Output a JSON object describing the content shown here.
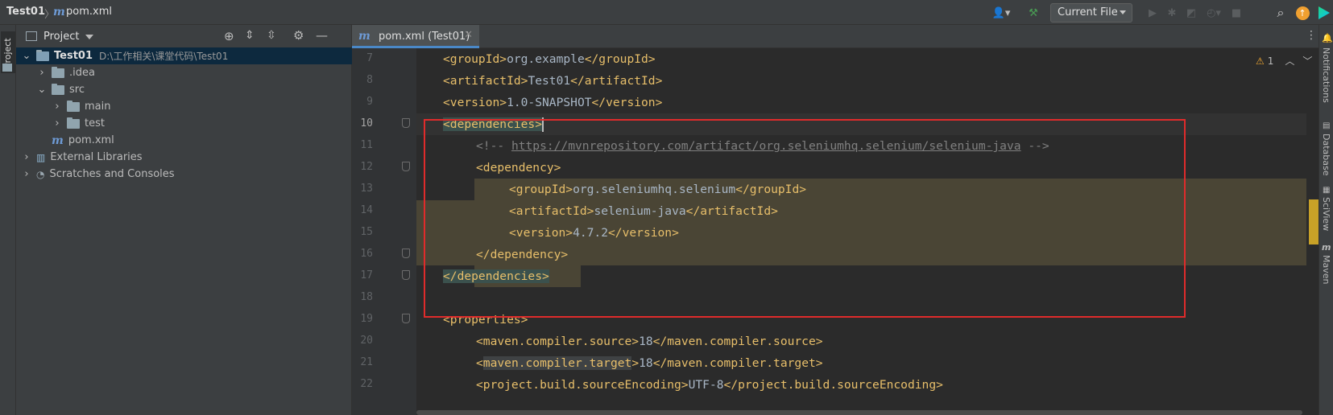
{
  "breadcrumb": {
    "project": "Test01",
    "file": "pom.xml"
  },
  "toolbar": {
    "run_config": "Current File"
  },
  "left_stripe": {
    "label": "Project"
  },
  "project_panel": {
    "title": "Project",
    "tree": [
      {
        "label": "Test01",
        "hint": "D:\\工作相关\\课堂代码\\Test01"
      },
      {
        "label": ".idea"
      },
      {
        "label": "src"
      },
      {
        "label": "main"
      },
      {
        "label": "test"
      },
      {
        "label": "pom.xml"
      },
      {
        "label": "External Libraries"
      },
      {
        "label": "Scratches and Consoles"
      }
    ]
  },
  "editor": {
    "tab_label": "pom.xml (Test01)",
    "warnings": "1",
    "line_numbers": [
      "7",
      "8",
      "9",
      "10",
      "11",
      "12",
      "13",
      "14",
      "15",
      "16",
      "17",
      "18",
      "19",
      "20",
      "21",
      "22"
    ],
    "lines": {
      "l7": "org.example",
      "l8": "Test01",
      "l9": "1.0-SNAPSHOT",
      "l11_url": "https://mvnrepository.com/artifact/org.seleniumhq.selenium/selenium-java",
      "l13": "org.seleniumhq.selenium",
      "l14": "selenium-java",
      "l15": "4.7.2",
      "l20": "18",
      "l21": "18",
      "l22": "UTF-8"
    }
  },
  "right_stripe": [
    "Notifications",
    "Database",
    "SciView",
    "Maven"
  ],
  "colors": {
    "accent": "#4a88c7",
    "highlight_box": "#e02b2b",
    "tag": "#e8bf6a"
  }
}
